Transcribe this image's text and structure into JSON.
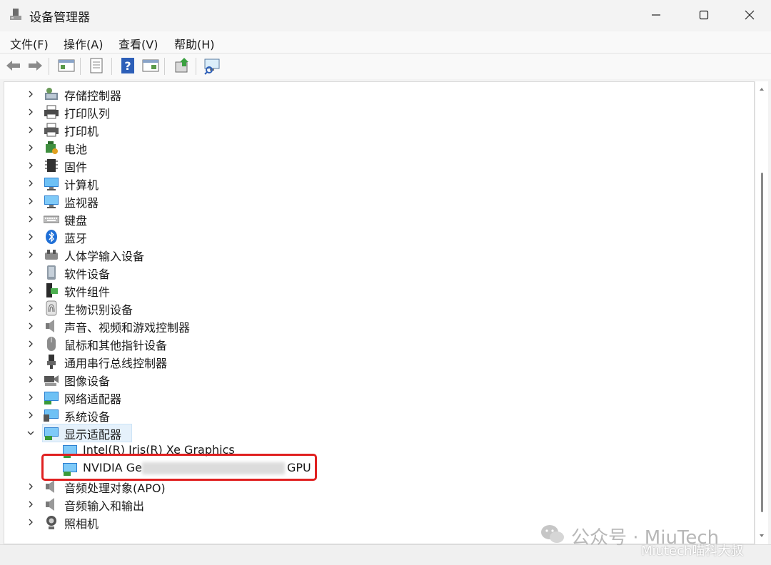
{
  "window": {
    "title": "设备管理器"
  },
  "menu": [
    "文件(F)",
    "操作(A)",
    "查看(V)",
    "帮助(H)"
  ],
  "toolbar_icons": [
    "back-icon",
    "forward-icon",
    "properties-view-icon",
    "document-icon",
    "help-icon",
    "action-view-icon",
    "update-driver-icon",
    "scan-hardware-icon"
  ],
  "tree": {
    "categories": [
      {
        "label": "存储控制器",
        "icon": "storage-controller-icon",
        "expanded": false
      },
      {
        "label": "打印队列",
        "icon": "printer-queue-icon",
        "expanded": false
      },
      {
        "label": "打印机",
        "icon": "printer-icon",
        "expanded": false
      },
      {
        "label": "电池",
        "icon": "battery-icon",
        "expanded": false
      },
      {
        "label": "固件",
        "icon": "firmware-icon",
        "expanded": false
      },
      {
        "label": "计算机",
        "icon": "computer-icon",
        "expanded": false
      },
      {
        "label": "监视器",
        "icon": "monitor-icon",
        "expanded": false
      },
      {
        "label": "键盘",
        "icon": "keyboard-icon",
        "expanded": false
      },
      {
        "label": "蓝牙",
        "icon": "bluetooth-icon",
        "expanded": false
      },
      {
        "label": "人体学输入设备",
        "icon": "hid-icon",
        "expanded": false
      },
      {
        "label": "软件设备",
        "icon": "software-device-icon",
        "expanded": false
      },
      {
        "label": "软件组件",
        "icon": "software-component-icon",
        "expanded": false
      },
      {
        "label": "生物识别设备",
        "icon": "fingerprint-icon",
        "expanded": false
      },
      {
        "label": "声音、视频和游戏控制器",
        "icon": "speaker-icon",
        "expanded": false
      },
      {
        "label": "鼠标和其他指针设备",
        "icon": "mouse-icon",
        "expanded": false
      },
      {
        "label": "通用串行总线控制器",
        "icon": "usb-icon",
        "expanded": false
      },
      {
        "label": "图像设备",
        "icon": "camera-device-icon",
        "expanded": false
      },
      {
        "label": "网络适配器",
        "icon": "network-adapter-icon",
        "expanded": false
      },
      {
        "label": "系统设备",
        "icon": "system-device-icon",
        "expanded": false
      },
      {
        "label": "显示适配器",
        "icon": "display-adapter-icon",
        "expanded": true,
        "selected": true
      }
    ],
    "display_children": [
      {
        "label": "Intel(R) Iris(R) Xe Graphics",
        "icon": "display-adapter-icon"
      },
      {
        "label_start": "NVIDIA Ge",
        "label_end": "GPU",
        "icon": "display-adapter-icon",
        "highlighted": true
      }
    ],
    "after": [
      {
        "label": "音频处理对象(APO)",
        "icon": "speaker-icon",
        "expanded": false
      },
      {
        "label": "音频输入和输出",
        "icon": "speaker-icon",
        "expanded": false
      },
      {
        "label": "照相机",
        "icon": "webcam-icon",
        "expanded": false
      }
    ]
  },
  "watermark": {
    "line1": "公众号 · MiuTech",
    "line2": "Miutech喵科大叔"
  }
}
